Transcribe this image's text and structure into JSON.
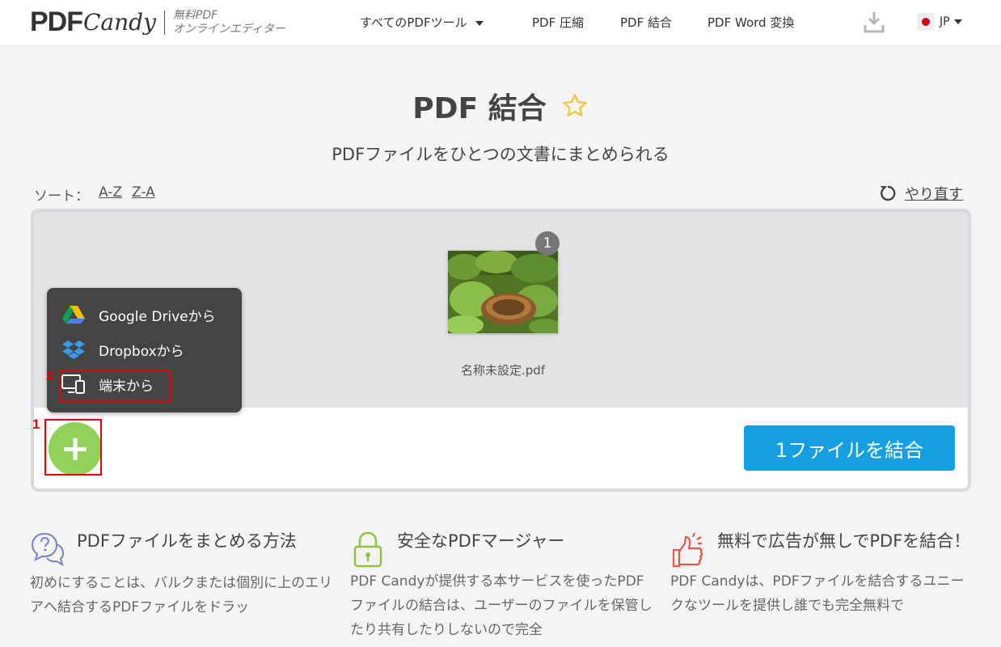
{
  "header": {
    "logo_main": "PDF",
    "logo_script": "Candy",
    "logo_sub_line1": "無料PDF",
    "logo_sub_line2": "オンラインエディター",
    "nav": [
      "すべてのPDFツール",
      "PDF 圧縮",
      "PDF 結合",
      "PDF Word 変換"
    ],
    "lang": "JP"
  },
  "main": {
    "title": "PDF 結合",
    "subtitle": "PDFファイルをひとつの文書にまとめられる",
    "sort_label": "ソート：",
    "sort_az": "A-Z",
    "sort_za": "Z-A",
    "redo": "やり直す"
  },
  "file": {
    "number": "1",
    "name": "名称未設定.pdf"
  },
  "dropdown": {
    "google_drive": "Google Driveから",
    "dropbox": "Dropboxから",
    "device": "端末から"
  },
  "annotations": {
    "n1": "1",
    "n2": "2"
  },
  "actions": {
    "add": "+",
    "combine": "1ファイルを結合"
  },
  "info": [
    {
      "title": "PDFファイルをまとめる方法",
      "body": "初めにすることは、バルクまたは個別に上のエリアへ結合するPDFファイルをドラッ"
    },
    {
      "title": "安全なPDFマージャー",
      "body": "PDF Candyが提供する本サービスを使ったPDFファイルの結合は、ユーザーのファイルを保管したり共有したりしないので完全"
    },
    {
      "title": "無料で広告が無しでPDFを結合！",
      "body": "PDF Candyは、PDFファイルを結合するユニークなツールを提供し誰でも完全無料で"
    }
  ],
  "colors": {
    "accent_blue": "#14a0e0",
    "add_green": "#8fd257",
    "annotation_red": "#e60000",
    "star_yellow": "#f5c23a"
  }
}
